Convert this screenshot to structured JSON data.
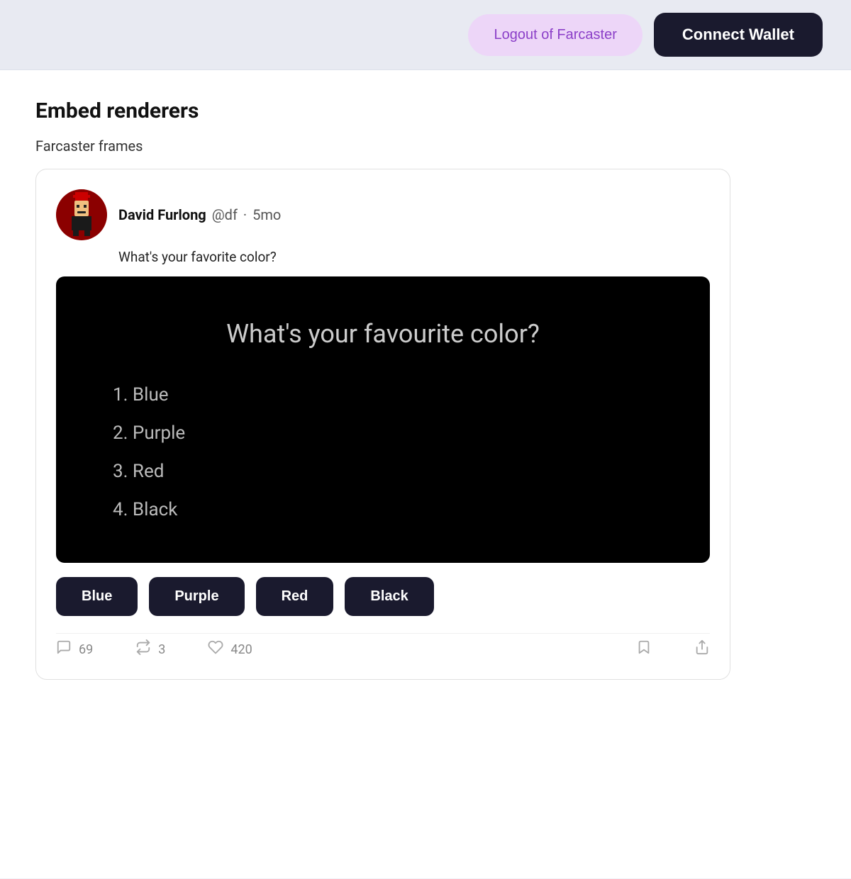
{
  "header": {
    "logout_label": "Logout of Farcaster",
    "connect_label": "Connect Wallet"
  },
  "page": {
    "section_title": "Embed renderers",
    "subsection_title": "Farcaster frames"
  },
  "post": {
    "author_name": "David Furlong",
    "author_handle": "@df",
    "time_ago": "5mo",
    "post_text": "What's your favorite color?",
    "frame": {
      "title": "What's your favourite color?",
      "options": [
        "1. Blue",
        "2. Purple",
        "3. Red",
        "4. Black"
      ]
    },
    "buttons": [
      {
        "label": "Blue"
      },
      {
        "label": "Purple"
      },
      {
        "label": "Red"
      },
      {
        "label": "Black"
      }
    ],
    "stats": {
      "comments": "69",
      "reposts": "3",
      "likes": "420"
    }
  }
}
